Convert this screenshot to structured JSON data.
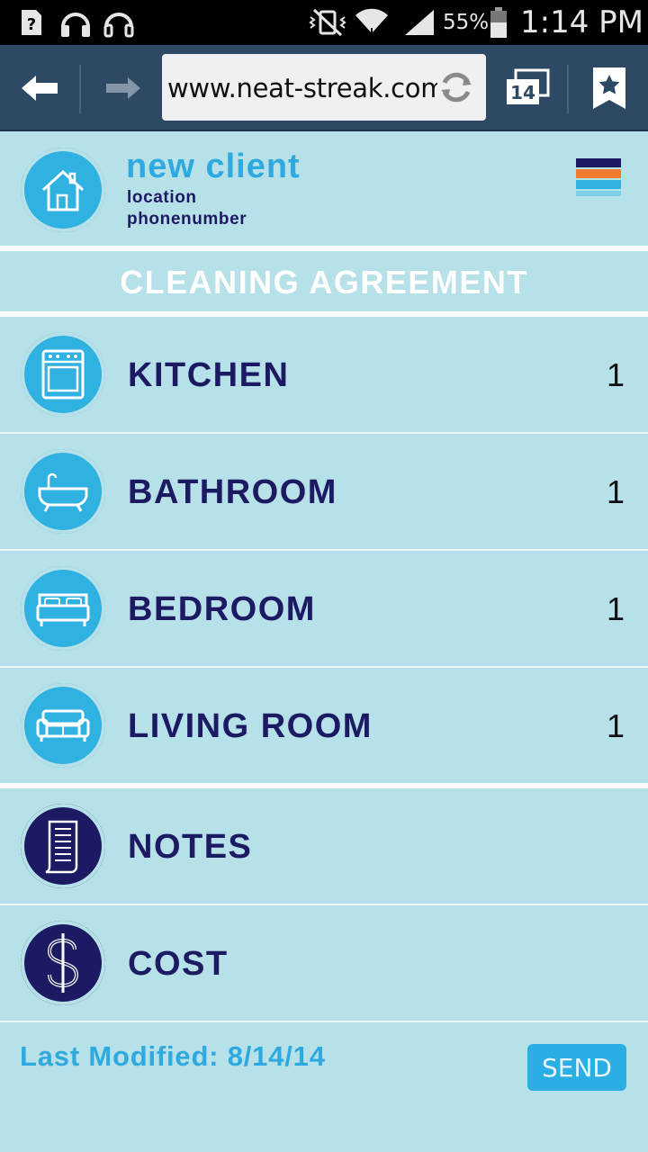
{
  "status_bar": {
    "battery": "55%",
    "time": "1:14 PM"
  },
  "browser": {
    "url": "www.neat-streak.com",
    "tab_count": "14"
  },
  "header": {
    "client_name": "new client",
    "location": "location",
    "phone": "phonenumber",
    "menu_colors": [
      "#1c1a63",
      "#f07b2c",
      "#2fb1e1"
    ]
  },
  "section_title": "CLEANING AGREEMENT",
  "rooms": [
    {
      "label": "KITCHEN",
      "count": "1",
      "icon": "kitchen-stove-icon"
    },
    {
      "label": "BATHROOM",
      "count": "1",
      "icon": "bathtub-icon"
    },
    {
      "label": "BEDROOM",
      "count": "1",
      "icon": "bed-icon"
    },
    {
      "label": "LIVING ROOM",
      "count": "1",
      "icon": "sofa-icon"
    }
  ],
  "extras": [
    {
      "label": "NOTES",
      "icon": "notes-scroll-icon"
    },
    {
      "label": "COST",
      "icon": "dollar-icon"
    }
  ],
  "footer": {
    "last_modified": "Last Modified: 8/14/14",
    "send_label": "SEND"
  },
  "colors": {
    "background": "#b7e1e8",
    "accent_blue": "#2fb1e1",
    "navy": "#1c1a63",
    "toolbar": "#2d4963"
  }
}
